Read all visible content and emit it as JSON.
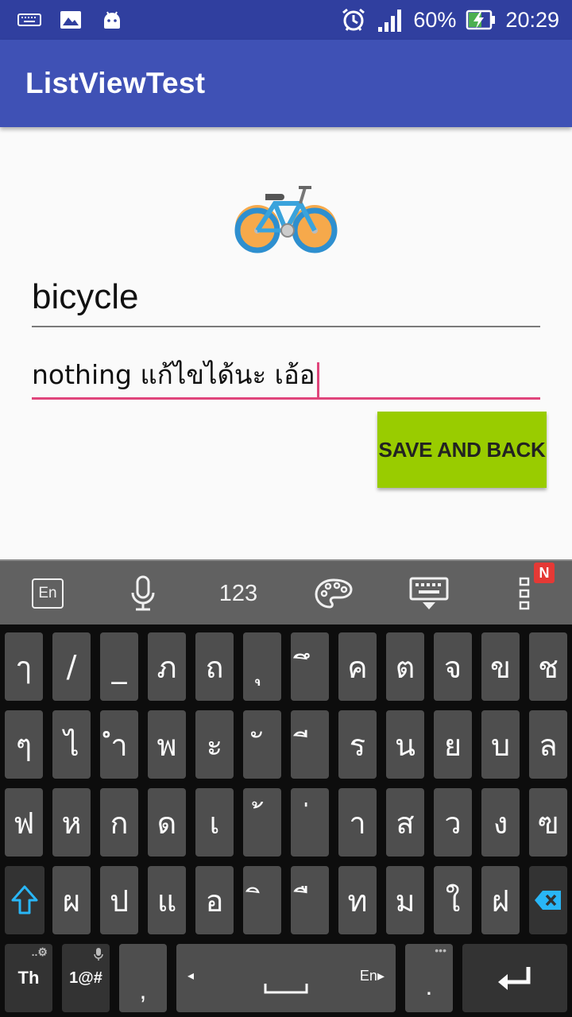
{
  "status_bar": {
    "battery": "60%",
    "time": "20:29",
    "icons": [
      "keyboard-icon",
      "image-icon",
      "android-icon",
      "alarm-icon",
      "signal-icon",
      "battery-charging-icon"
    ]
  },
  "app_bar": {
    "title": "ListViewTest"
  },
  "main": {
    "image_icon": "bicycle-icon",
    "name_value": "bicycle",
    "description_value": "nothing แก้ไขได้นะ เอ้อ",
    "save_button_label": "SAVE AND BACK"
  },
  "keyboard": {
    "toolbar": {
      "lang_label": "En",
      "numbers_label": "123",
      "badge": "N",
      "icons": [
        "language-icon",
        "microphone-icon",
        "numbers-key",
        "palette-icon",
        "keyboard-hide-icon",
        "more-icon"
      ]
    },
    "rows": [
      [
        "ๅ",
        "/",
        "_",
        "ภ",
        "ถ",
        "ุ",
        "ึ",
        "ค",
        "ต",
        "จ",
        "ข",
        "ช"
      ],
      [
        "ๆ",
        "ไ",
        "ำ",
        "พ",
        "ะ",
        "ั",
        "ี",
        "ร",
        "น",
        "ย",
        "บ",
        "ล"
      ],
      [
        "ฟ",
        "ห",
        "ก",
        "ด",
        "เ",
        "้",
        "่",
        "า",
        "ส",
        "ว",
        "ง",
        "ฃ"
      ],
      [
        "ผ",
        "ป",
        "แ",
        "อ",
        "ิ",
        "ื",
        "ท",
        "ม",
        "ใ",
        "ฝ"
      ]
    ],
    "bottom": {
      "lang_key": "Th",
      "symbols_key": "1@#",
      "comma_key": ",",
      "space_lang": "En",
      "period_key": "."
    }
  },
  "colors": {
    "status_bar": "#303f9f",
    "app_bar": "#3f51b5",
    "accent": "#e0457b",
    "button": "#99cc00",
    "keyboard_bg": "#0d0d0d",
    "key_bg": "#4e4e4e",
    "shift_color": "#29b6f6"
  }
}
